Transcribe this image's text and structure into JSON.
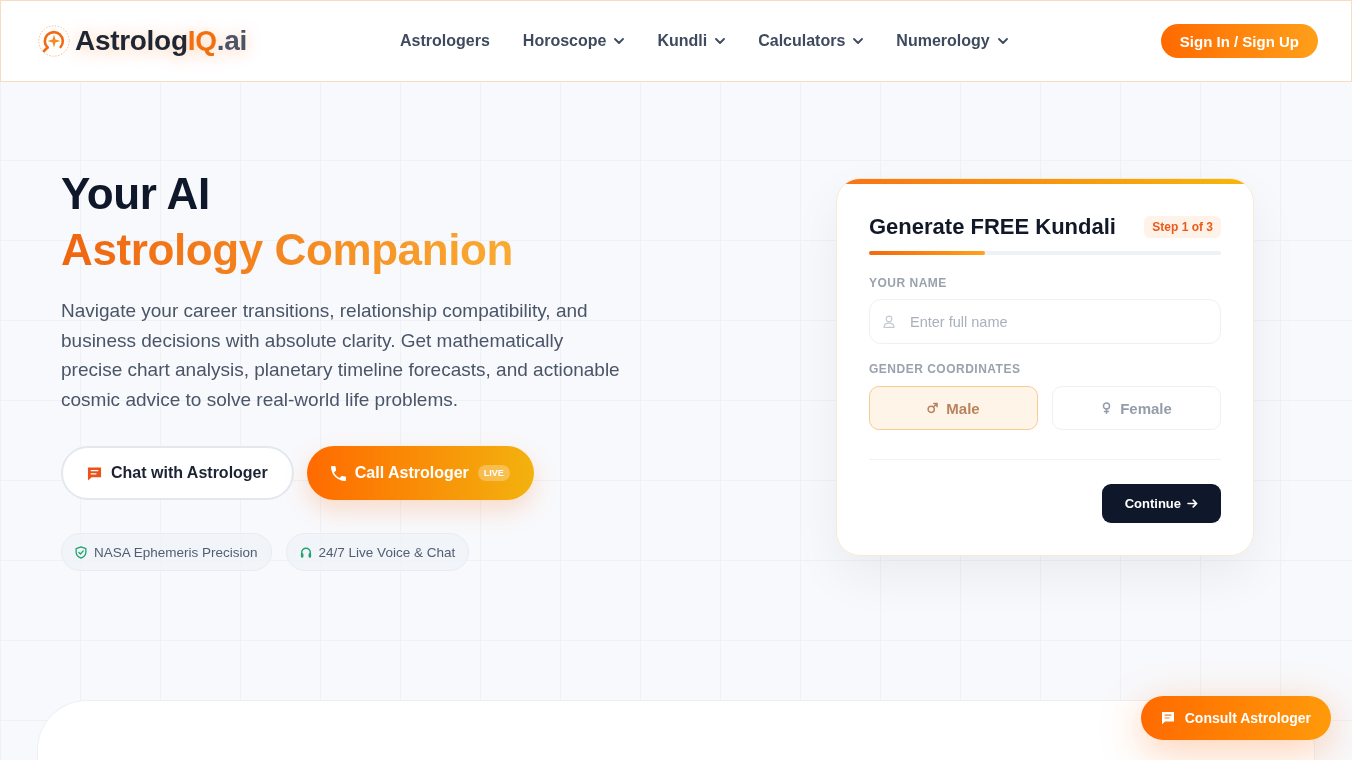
{
  "header": {
    "logo": {
      "parts": [
        {
          "text": "Astrolog",
          "kind": "base"
        },
        {
          "text": "IQ",
          "kind": "accent"
        },
        {
          "text": ".ai",
          "kind": "suffix"
        }
      ]
    },
    "nav": [
      {
        "label": "Astrologers",
        "has_menu": false
      },
      {
        "label": "Horoscope",
        "has_menu": true
      },
      {
        "label": "Kundli",
        "has_menu": true
      },
      {
        "label": "Calculators",
        "has_menu": true
      },
      {
        "label": "Numerology",
        "has_menu": true
      }
    ],
    "auth_button": "Sign In / Sign Up"
  },
  "hero": {
    "heading": [
      {
        "text": "Your AI",
        "kind": "plain"
      },
      {
        "text": "Astrology Companion",
        "kind": "accent"
      }
    ],
    "description": "Navigate your career transitions, relationship compatibility, and business decisions with absolute clarity. Get mathematically precise chart analysis, planetary timeline forecasts, and actionable cosmic advice to solve real-world life problems.",
    "actions": [
      {
        "label": "Chat with Astrologer",
        "kind": "outline"
      },
      {
        "label": "Call Astrologer",
        "kind": "primary",
        "badge": "LIVE"
      }
    ],
    "features": [
      "NASA Ephemeris Precision",
      "24/7 Live Voice & Chat"
    ]
  },
  "kundali_form": {
    "title": "Generate FREE Kundali",
    "step": "Step 1 of 3",
    "progress": {
      "level": 0.33
    },
    "name_field": {
      "label": "YOUR NAME",
      "placeholder": "Enter full name"
    },
    "gender": {
      "label": "GENDER COORDINATES",
      "options": [
        {
          "label": "Male",
          "selected": true
        },
        {
          "label": "Female",
          "selected": false
        }
      ]
    },
    "continue_button": "Continue"
  },
  "floating_button": "Consult Astrologer"
}
